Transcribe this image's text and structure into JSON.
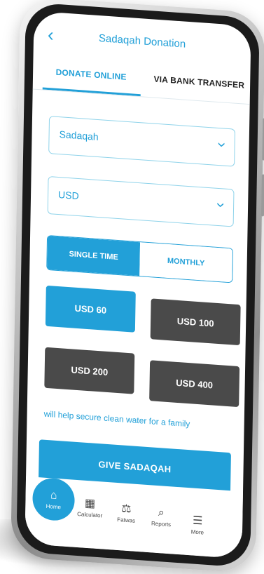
{
  "header": {
    "title": "Sadaqah Donation",
    "back_icon": "chevron-left-icon"
  },
  "tabs": [
    {
      "label": "DONATE ONLINE",
      "active": true
    },
    {
      "label": "VIA BANK TRANSFER",
      "active": false
    }
  ],
  "form": {
    "donation_type": {
      "value": "Sadaqah",
      "icon": "chevron-down-icon"
    },
    "currency": {
      "value": "USD",
      "icon": "chevron-down-icon"
    },
    "frequency": [
      {
        "label": "SINGLE TIME",
        "selected": true
      },
      {
        "label": "MONTHLY",
        "selected": false
      }
    ],
    "amounts": [
      {
        "label": "USD 60",
        "selected": true
      },
      {
        "label": "USD 100",
        "selected": false
      },
      {
        "label": "USD 200",
        "selected": false
      },
      {
        "label": "USD 400",
        "selected": false
      }
    ],
    "impact_text": "will help secure clean water for a family",
    "submit_label": "GIVE SADAQAH"
  },
  "bottom_nav": [
    {
      "label": "Home",
      "icon": "home-icon",
      "active": true
    },
    {
      "label": "Calculator",
      "icon": "calculator-icon"
    },
    {
      "label": "Fatwas",
      "icon": "scale-icon"
    },
    {
      "label": "Reports",
      "icon": "search-icon"
    },
    {
      "label": "More",
      "icon": "menu-icon"
    }
  ],
  "colors": {
    "accent": "#22a0d8",
    "dark_button": "#4a4a4a"
  }
}
